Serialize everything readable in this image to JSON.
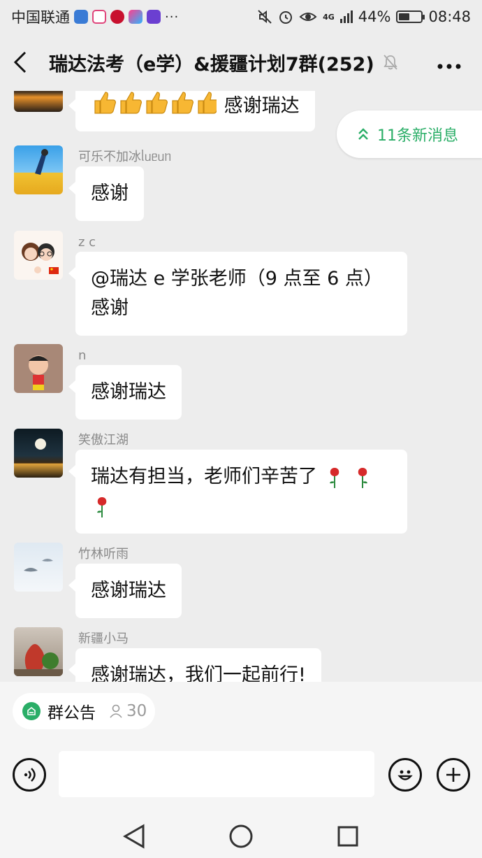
{
  "status_bar": {
    "carrier": "中国联通",
    "network": "4G",
    "battery": "44%",
    "time": "08:48",
    "battery_level": 0.44
  },
  "header": {
    "title": "瑞达法考（e学）&援疆计划7群(252)",
    "icons": [
      "back-icon",
      "mute-bell-icon",
      "more-icon"
    ]
  },
  "new_messages": {
    "label": "11条新消息"
  },
  "messages": [
    {
      "sender": "",
      "text": "感谢瑞达",
      "thumbs": 5
    },
    {
      "sender": "可乐不加冰ᥣᥙᥱᥙᥒ",
      "text": "感谢"
    },
    {
      "sender": "z c",
      "lines": [
        "@瑞达 e 学张老师（9 点至 6 点）",
        "感谢"
      ]
    },
    {
      "sender": "n",
      "text": "感谢瑞达"
    },
    {
      "sender": "笑傲江湖",
      "text": "瑞达有担当，老师们辛苦了"
    },
    {
      "sender": "竹林听雨",
      "text": "感谢瑞达"
    },
    {
      "sender": "新疆小马",
      "text": "感谢瑞达，我们一起前行!"
    }
  ],
  "notice_bar": {
    "label": "群公告",
    "count": "30"
  },
  "colors": {
    "accent_green": "#2aae67",
    "chat_background": "#ededed",
    "bubble": "#ffffff"
  }
}
